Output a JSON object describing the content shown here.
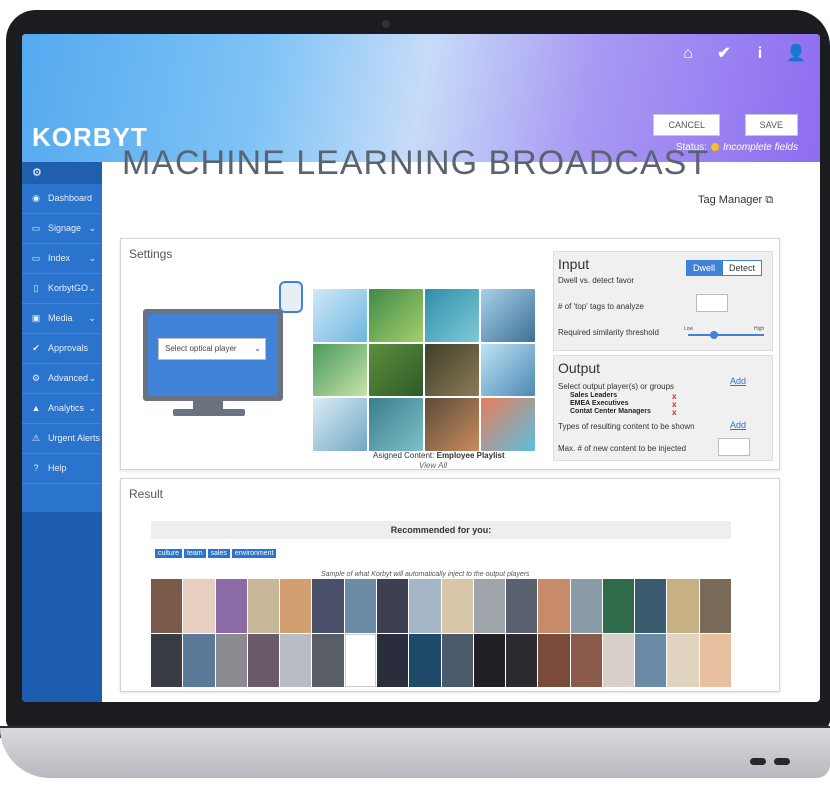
{
  "header": {
    "logo": "KORBYT",
    "page_title": "MACHINE LEARNING BROADCAST",
    "cancel_label": "CANCEL",
    "save_label": "SAVE",
    "status_label": "Status:",
    "status_value": "Incomplete fields",
    "icons": [
      "home-icon",
      "check-icon",
      "info-icon",
      "user-icon"
    ]
  },
  "sidebar": {
    "items": [
      {
        "label": "Dashboard",
        "icon": "dashboard-icon",
        "chevron": false
      },
      {
        "label": "Signage",
        "icon": "signage-icon",
        "chevron": true
      },
      {
        "label": "Index",
        "icon": "index-icon",
        "chevron": true
      },
      {
        "label": "KorbytGO",
        "icon": "mobile-icon",
        "chevron": true
      },
      {
        "label": "Media",
        "icon": "media-icon",
        "chevron": true
      },
      {
        "label": "Approvals",
        "icon": "check-circle-icon",
        "chevron": false
      },
      {
        "label": "Advanced",
        "icon": "gears-icon",
        "chevron": true
      },
      {
        "label": "Analytics",
        "icon": "chart-icon",
        "chevron": true
      },
      {
        "label": "Urgent Alerts",
        "icon": "alert-icon",
        "chevron": false
      },
      {
        "label": "Help",
        "icon": "help-icon",
        "chevron": false
      }
    ]
  },
  "tag_manager": "Tag Manager",
  "settings": {
    "label": "Settings",
    "player_select": "Select optical player",
    "caption_prefix": "Asigned Content:",
    "caption_name": "Employee Playlist",
    "view_all": "View All"
  },
  "input": {
    "title": "Input",
    "dwell_label": "Dwell vs. detect favor",
    "dwell_option": "Dwell",
    "detect_option": "Detect",
    "tags_label": "# of 'top' tags to analyze",
    "threshold_label": "Required similarity threshold",
    "low": "Low",
    "high": "High"
  },
  "output": {
    "title": "Output",
    "select_label": "Select output player(s) or groups",
    "groups": [
      "Sales Leaders",
      "EMEA Executives",
      "Contat Center Managers"
    ],
    "add_label": "Add",
    "types_label": "Types of resulting content to be shown",
    "max_label": "Max. # of new content to be injected"
  },
  "result": {
    "label": "Result",
    "recommended": "Recommended for you:",
    "tags": [
      "culture",
      "team",
      "sales",
      "environment"
    ],
    "sample_note": "Sample of what Korbyt will automatically inject to the output players"
  },
  "colors": {
    "accent": "#2a74cd",
    "status_dot": "#f4c21c"
  }
}
